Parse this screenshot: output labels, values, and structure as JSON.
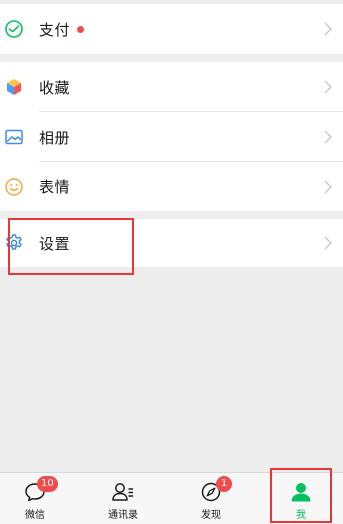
{
  "menu": {
    "pay": {
      "label": "支付",
      "icon": "wechat-pay-icon",
      "has_dot": true
    },
    "favorites": {
      "label": "收藏",
      "icon": "cube-icon"
    },
    "album": {
      "label": "相册",
      "icon": "image-icon"
    },
    "stickers": {
      "label": "表情",
      "icon": "smiley-icon"
    },
    "settings": {
      "label": "设置",
      "icon": "gear-icon"
    }
  },
  "tabbar": {
    "tabs": [
      {
        "label": "微信",
        "icon": "chat-bubble-icon",
        "badge": "10"
      },
      {
        "label": "通讯录",
        "icon": "contacts-icon",
        "badge": ""
      },
      {
        "label": "发现",
        "icon": "compass-icon",
        "badge": "1"
      },
      {
        "label": "我",
        "icon": "person-icon",
        "badge": ""
      }
    ],
    "active_tab": "我"
  },
  "colors": {
    "accent": "#07c160",
    "badge": "#f24b4b",
    "highlight": "#e53935",
    "background": "#ededed"
  }
}
